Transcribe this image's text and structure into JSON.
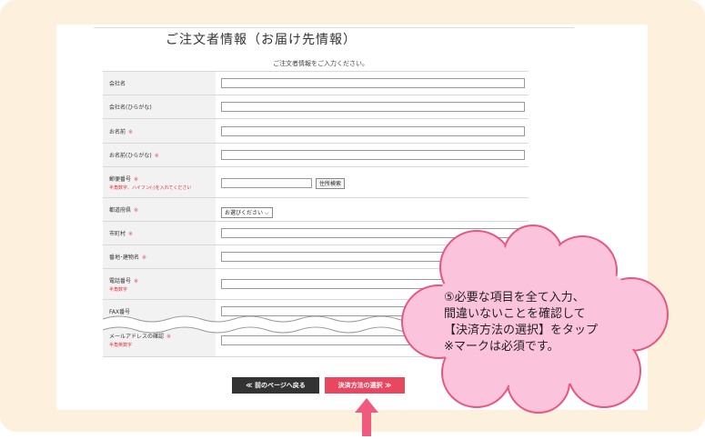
{
  "form": {
    "title": "ご注文者情報（お届け先情報）",
    "subtitle": "ご注文者情報をご入力ください。",
    "required_mark": "※",
    "rows": [
      {
        "label": "会社名"
      },
      {
        "label": "会社名(ひらがな)"
      },
      {
        "label": "お名前"
      },
      {
        "label": "お名前(ひらがな)"
      },
      {
        "label": "郵便番号",
        "note": "半角数字、ハイフン(-)を入れてください"
      },
      {
        "label": "都道府県"
      },
      {
        "label": "市町村"
      },
      {
        "label": "番地･建物名"
      },
      {
        "label": "電話番号",
        "note": "半角数字"
      },
      {
        "label": "FAX番号"
      },
      {
        "label": "メールアドレスの確認",
        "note": "半角英数字"
      }
    ],
    "zip_search_label": "住所検索",
    "prefecture_selected": "お選びください"
  },
  "buttons": {
    "back": "≪ 前のページへ戻る",
    "next": "決済方法の選択 ≫"
  },
  "callout": {
    "lines": [
      "⑤必要な項目を全て入力、",
      "間違いないことを確認して",
      "【決済方法の選択】をタップ",
      "※マークは必須です。"
    ]
  },
  "colors": {
    "frame": "#fdf0dc",
    "cloud": "#fbc4dc",
    "cloud_border": "#e8567f",
    "next_button": "#e8475f",
    "back_button": "#333333",
    "arrow": "#f05a7e"
  }
}
